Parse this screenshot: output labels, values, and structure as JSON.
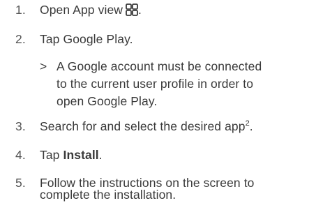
{
  "steps": [
    {
      "number": "1.",
      "text": "Open App view",
      "after_icon": ".",
      "icon": "app-view-grid-icon"
    },
    {
      "number": "2.",
      "text": "Tap Google Play."
    },
    {
      "number": "3.",
      "text": "Search for and select the desired app",
      "superscript": "2",
      "after_sup": "."
    },
    {
      "number": "4.",
      "text_prefix": "Tap ",
      "bold": "Install",
      "text_suffix": "."
    },
    {
      "number": "5.",
      "lines": [
        "Follow the instructions on the screen to",
        "complete the installation."
      ]
    }
  ],
  "note": {
    "marker": ">",
    "lines": [
      "A Google account must be connected",
      "to the current user profile in order to",
      "open Google Play."
    ]
  }
}
